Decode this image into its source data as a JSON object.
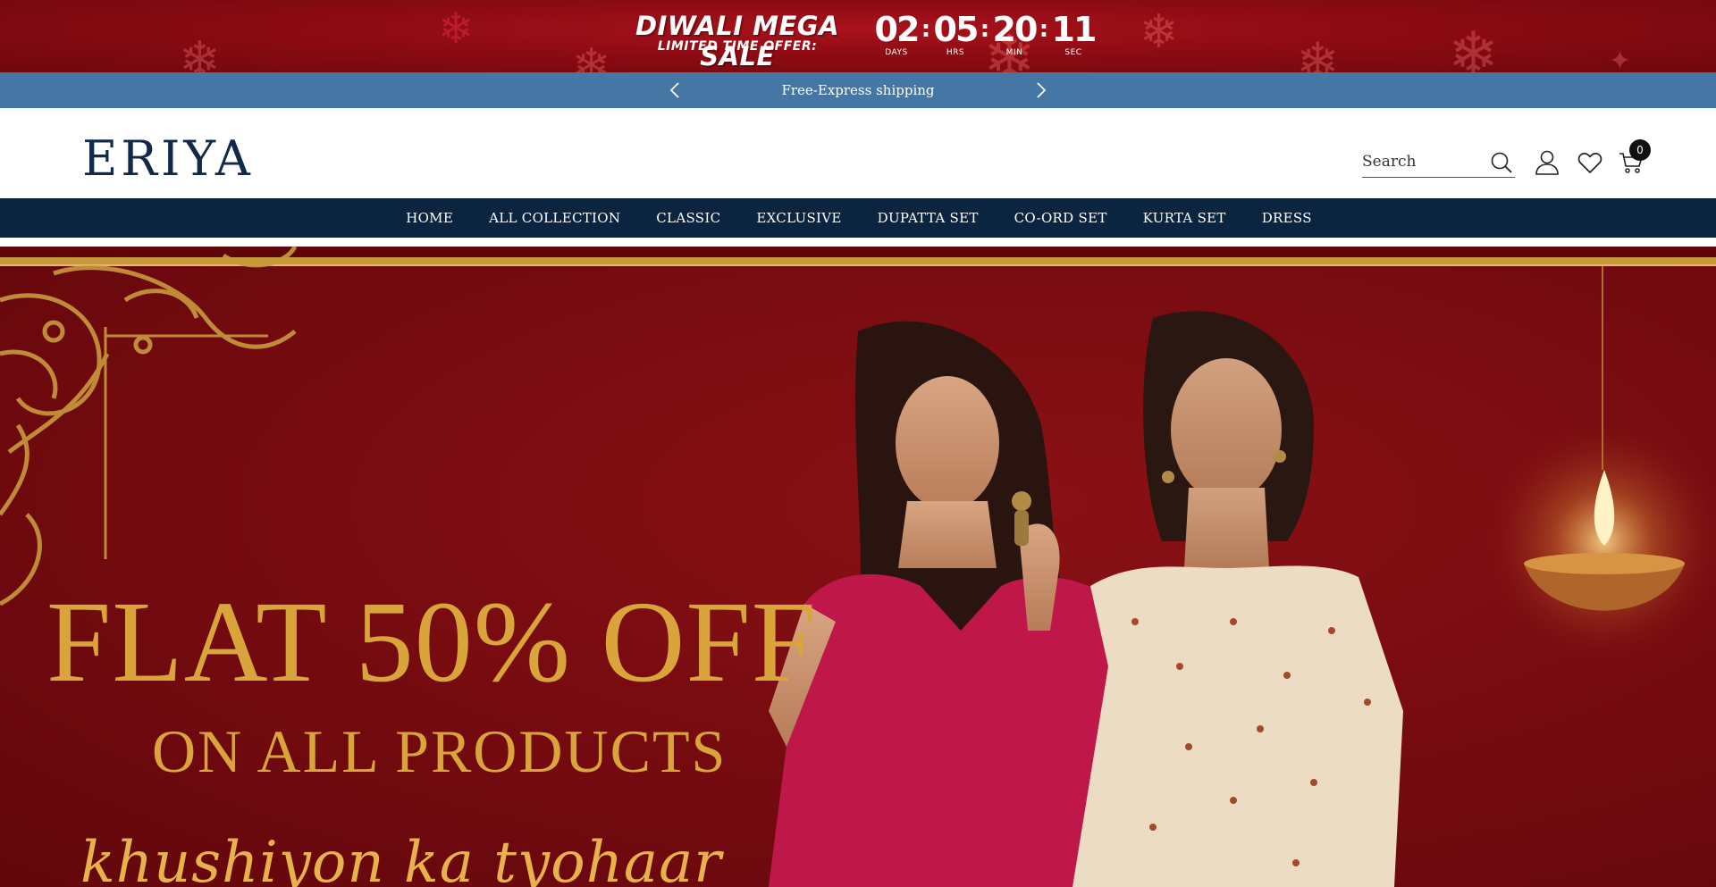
{
  "sale_banner": {
    "title": "DIWALI MEGA SALE",
    "subtitle": "LIMITED TIME OFFER:",
    "countdown": [
      {
        "value": "02",
        "label": "DAYS"
      },
      {
        "value": "05",
        "label": "HRS"
      },
      {
        "value": "20",
        "label": "MIN"
      },
      {
        "value": "11",
        "label": "SEC"
      }
    ],
    "separator": ":",
    "background_color": "#8d0b13"
  },
  "announcement_bar": {
    "text": "Free-Express shipping",
    "prev_icon": "chevron-left-icon",
    "next_icon": "chevron-right-icon",
    "background_color": "#4677a4"
  },
  "header": {
    "logo_text": "ERIYA",
    "search": {
      "placeholder": "Search",
      "value": ""
    },
    "icons": [
      "search-icon",
      "user-icon",
      "heart-icon",
      "cart-icon"
    ],
    "cart_count": "0"
  },
  "nav": {
    "items": [
      "HOME",
      "ALL COLLECTION",
      "CLASSIC",
      "EXCLUSIVE",
      "DUPATTA SET",
      "CO-ORD SET",
      "KURTA SET",
      "DRESS"
    ],
    "background_color": "#0b2440"
  },
  "hero": {
    "headline": "FLAT 50% OFF",
    "subheadline": "ON ALL PRODUCTS",
    "tagline": "khushiyon ka tyohaar",
    "accent_color": "#d9a43a",
    "background_color": "#760b10"
  }
}
